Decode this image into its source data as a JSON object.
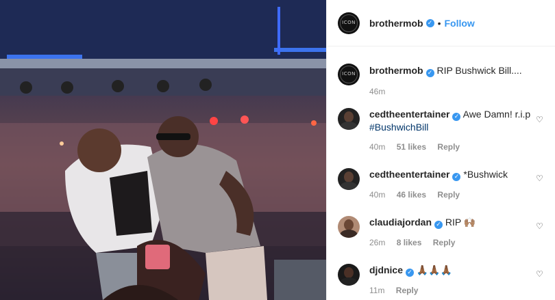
{
  "post": {
    "author": "brothermob",
    "follow_label": "Follow",
    "separator": "•",
    "caption": "RIP Bushwick Bill....",
    "caption_time": "46m"
  },
  "comments": [
    {
      "user": "cedtheentertainer",
      "text": "Awe Damn! r.i.p ",
      "hashtag": "#BushwichBill",
      "time": "40m",
      "likes": "51 likes",
      "reply": "Reply"
    },
    {
      "user": "cedtheentertainer",
      "text": "*Bushwick",
      "time": "40m",
      "likes": "46 likes",
      "reply": "Reply"
    },
    {
      "user": "claudiajordan",
      "text": "RIP 🙌🏽",
      "time": "26m",
      "likes": "8 likes",
      "reply": "Reply"
    },
    {
      "user": "djdnice",
      "text": "🙏🏾🙏🏾🙏🏾",
      "time": "11m",
      "reply": "Reply"
    }
  ],
  "icons": {
    "verified": "verified-badge-icon",
    "heart": "heart-outline-icon",
    "avatar_mark": "ICON"
  },
  "colors": {
    "link": "#3897f0",
    "muted": "#8e8e8e",
    "hashtag": "#003569"
  }
}
